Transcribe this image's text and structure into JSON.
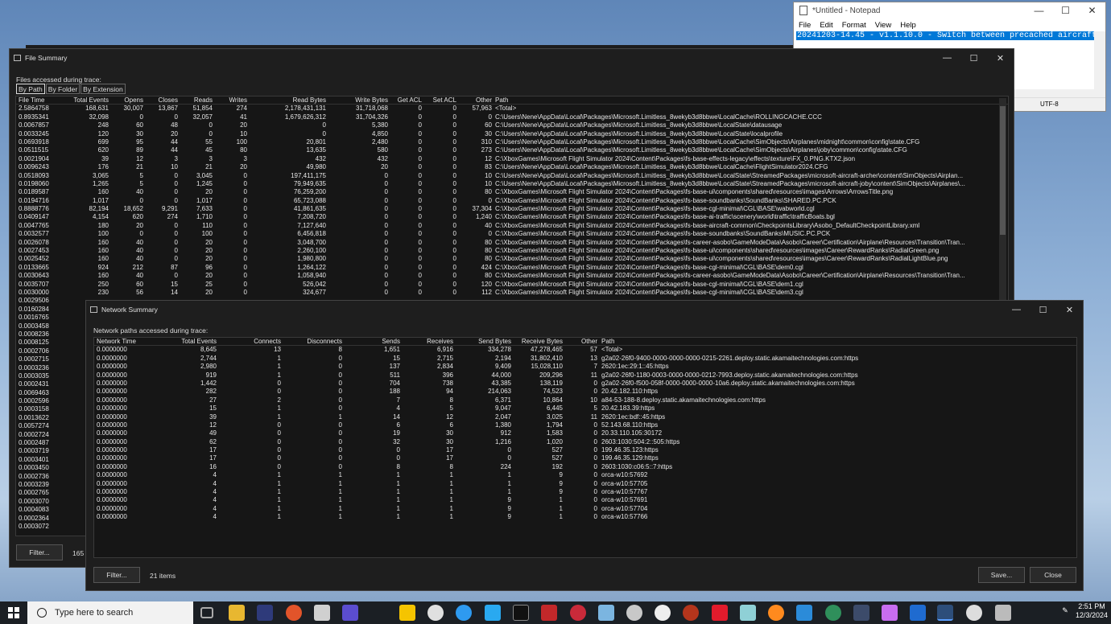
{
  "notepad": {
    "title": "*Untitled - Notepad",
    "menu": [
      "File",
      "Edit",
      "Format",
      "View",
      "Help"
    ],
    "selected_text": "20241203-14.45 - v1.1.10.0 - Switch between precached aircraft",
    "status_line": "F)",
    "status_encoding": "UTF-8"
  },
  "file_summary": {
    "title": "File Summary",
    "label": "Files accessed during trace:",
    "tabs": [
      "By Path",
      "By Folder",
      "By Extension"
    ],
    "active_tab": "By Path",
    "columns": [
      "File Time",
      "Total Events",
      "Opens",
      "Closes",
      "Reads",
      "Writes",
      "Read Bytes",
      "Write Bytes",
      "Get ACL",
      "Set ACL",
      "Other",
      "Path"
    ],
    "rows": [
      [
        "2.5864758",
        "168,631",
        "30,007",
        "13,867",
        "51,854",
        "274",
        "2,178,431,131",
        "31,718,068",
        "0",
        "0",
        "57,963",
        "<Total>"
      ],
      [
        "0.8935341",
        "32,098",
        "0",
        "0",
        "32,057",
        "41",
        "1,679,626,312",
        "31,704,326",
        "0",
        "0",
        "0",
        "C:\\Users\\Nene\\AppData\\Local\\Packages\\Microsoft.Limitless_8wekyb3d8bbwe\\LocalCache\\ROLLINGCACHE.CCC"
      ],
      [
        "0.0067857",
        "248",
        "60",
        "48",
        "0",
        "20",
        "0",
        "5,380",
        "0",
        "0",
        "60",
        "C:\\Users\\Nene\\AppData\\Local\\Packages\\Microsoft.Limitless_8wekyb3d8bbwe\\LocalState\\datausage"
      ],
      [
        "0.0033245",
        "120",
        "30",
        "20",
        "0",
        "10",
        "0",
        "4,850",
        "0",
        "0",
        "30",
        "C:\\Users\\Nene\\AppData\\Local\\Packages\\Microsoft.Limitless_8wekyb3d8bbwe\\LocalState\\localprofile"
      ],
      [
        "0.0693918",
        "699",
        "95",
        "44",
        "55",
        "100",
        "20,801",
        "2,480",
        "0",
        "0",
        "310",
        "C:\\Users\\Nene\\AppData\\Local\\Packages\\Microsoft.Limitless_8wekyb3d8bbwe\\LocalCache\\SimObjects\\Airplanes\\midnight\\common\\config\\state.CFG"
      ],
      [
        "0.0511515",
        "620",
        "89",
        "44",
        "45",
        "80",
        "13,635",
        "580",
        "0",
        "0",
        "273",
        "C:\\Users\\Nene\\AppData\\Local\\Packages\\Microsoft.Limitless_8wekyb3d8bbwe\\LocalCache\\SimObjects\\Airplanes\\joby\\common\\config\\state.CFG"
      ],
      [
        "0.0021904",
        "39",
        "12",
        "3",
        "3",
        "3",
        "432",
        "432",
        "0",
        "0",
        "12",
        "C:\\XboxGames\\Microsoft Flight Simulator 2024\\Content\\Packages\\fs-base-effects-legacy\\effects\\texture\\FX_0.PNG.KTX2.json"
      ],
      [
        "0.0096243",
        "176",
        "21",
        "10",
        "21",
        "20",
        "49,980",
        "20",
        "0",
        "0",
        "83",
        "C:\\Users\\Nene\\AppData\\Local\\Packages\\Microsoft.Limitless_8wekyb3d8bbwe\\LocalCache\\FlightSimulator2024.CFG"
      ],
      [
        "0.0518093",
        "3,065",
        "5",
        "0",
        "3,045",
        "0",
        "197,411,175",
        "0",
        "0",
        "0",
        "10",
        "C:\\Users\\Nene\\AppData\\Local\\Packages\\Microsoft.Limitless_8wekyb3d8bbwe\\LocalState\\StreamedPackages\\microsoft-aircraft-archer\\content\\SimObjects\\Airplan..."
      ],
      [
        "0.0198060",
        "1,265",
        "5",
        "0",
        "1,245",
        "0",
        "79,949,635",
        "0",
        "0",
        "0",
        "10",
        "C:\\Users\\Nene\\AppData\\Local\\Packages\\Microsoft.Limitless_8wekyb3d8bbwe\\LocalState\\StreamedPackages\\microsoft-aircraft-joby\\content\\SimObjects\\Airplanes\\..."
      ],
      [
        "0.0189587",
        "160",
        "40",
        "0",
        "20",
        "0",
        "76,259,200",
        "0",
        "0",
        "0",
        "80",
        "C:\\XboxGames\\Microsoft Flight Simulator 2024\\Content\\Packages\\fs-base-ui\\components\\shared\\resources\\images\\Arrows\\ArrowsTitle.png"
      ],
      [
        "0.0194716",
        "1,017",
        "0",
        "0",
        "1,017",
        "0",
        "65,723,088",
        "0",
        "0",
        "0",
        "0",
        "C:\\XboxGames\\Microsoft Flight Simulator 2024\\Content\\Packages\\fs-base-soundbanks\\SoundBanks\\SHARED.PC.PCK"
      ],
      [
        "0.8888776",
        "82,194",
        "18,652",
        "9,291",
        "7,633",
        "0",
        "41,861,635",
        "0",
        "0",
        "0",
        "37,304",
        "C:\\XboxGames\\Microsoft Flight Simulator 2024\\Content\\Packages\\fs-base-cgl-minimal\\CGL\\BASE\\wabworld.cgl"
      ],
      [
        "0.0409147",
        "4,154",
        "620",
        "274",
        "1,710",
        "0",
        "7,208,720",
        "0",
        "0",
        "0",
        "1,240",
        "C:\\XboxGames\\Microsoft Flight Simulator 2024\\Content\\Packages\\fs-base-ai-traffic\\scenery\\world\\traffic\\trafficBoats.bgl"
      ],
      [
        "0.0047765",
        "180",
        "20",
        "0",
        "110",
        "0",
        "7,127,640",
        "0",
        "0",
        "0",
        "40",
        "C:\\XboxGames\\Microsoft Flight Simulator 2024\\Content\\Packages\\fs-base-aircraft-common\\CheckpointsLibrary\\Asobo_DefaultCheckpointLibrary.xml"
      ],
      [
        "0.0032577",
        "100",
        "0",
        "0",
        "100",
        "0",
        "6,456,818",
        "0",
        "0",
        "0",
        "0",
        "C:\\XboxGames\\Microsoft Flight Simulator 2024\\Content\\Packages\\fs-base-soundbanks\\SoundBanks\\MUSIC.PC.PCK"
      ],
      [
        "0.0026078",
        "160",
        "40",
        "0",
        "20",
        "0",
        "3,048,700",
        "0",
        "0",
        "0",
        "80",
        "C:\\XboxGames\\Microsoft Flight Simulator 2024\\Content\\Packages\\fs-career-asobo\\GameModeData\\Asobo\\Career\\Certification\\Airplane\\Resources\\Transition\\Tran..."
      ],
      [
        "0.0027453",
        "160",
        "40",
        "0",
        "20",
        "0",
        "2,260,100",
        "0",
        "0",
        "0",
        "80",
        "C:\\XboxGames\\Microsoft Flight Simulator 2024\\Content\\Packages\\fs-base-ui\\components\\shared\\resources\\images\\Career\\RewardRanks\\RadialGreen.png"
      ],
      [
        "0.0025452",
        "160",
        "40",
        "0",
        "20",
        "0",
        "1,980,800",
        "0",
        "0",
        "0",
        "80",
        "C:\\XboxGames\\Microsoft Flight Simulator 2024\\Content\\Packages\\fs-base-ui\\components\\shared\\resources\\images\\Career\\RewardRanks\\RadialLightBlue.png"
      ],
      [
        "0.0133665",
        "924",
        "212",
        "87",
        "96",
        "0",
        "1,264,122",
        "0",
        "0",
        "0",
        "424",
        "C:\\XboxGames\\Microsoft Flight Simulator 2024\\Content\\Packages\\fs-base-cgl-minimal\\CGL\\BASE\\dem0.cgl"
      ],
      [
        "0.0030643",
        "160",
        "40",
        "0",
        "20",
        "0",
        "1,058,940",
        "0",
        "0",
        "0",
        "80",
        "C:\\XboxGames\\Microsoft Flight Simulator 2024\\Content\\Packages\\fs-career-asobo\\GameModeData\\Asobo\\Career\\Certification\\Airplane\\Resources\\Transition\\Tran..."
      ],
      [
        "0.0035707",
        "250",
        "60",
        "15",
        "25",
        "0",
        "526,042",
        "0",
        "0",
        "0",
        "120",
        "C:\\XboxGames\\Microsoft Flight Simulator 2024\\Content\\Packages\\fs-base-cgl-minimal\\CGL\\BASE\\dem1.cgl"
      ],
      [
        "0.0030000",
        "230",
        "56",
        "14",
        "20",
        "0",
        "324,677",
        "0",
        "0",
        "0",
        "112",
        "C:\\XboxGames\\Microsoft Flight Simulator 2024\\Content\\Packages\\fs-base-cgl-minimal\\CGL\\BASE\\dem3.cgl"
      ]
    ],
    "hidden_times": [
      "0.0029506",
      "0.0160284",
      "0.0016765",
      "0.0003458",
      "0.0008236",
      "0.0008125",
      "0.0002706",
      "0.0002715",
      "0.0003236",
      "0.0003035",
      "0.0002431",
      "0.0069463",
      "0.0002596",
      "0.0003158",
      "0.0013622",
      "0.0057274",
      "0.0002724",
      "0.0002487",
      "0.0003719",
      "0.0003401",
      "0.0003450",
      "0.0002736",
      "0.0003239",
      "0.0002765",
      "0.0003070",
      "0.0004083",
      "0.0002364",
      "0.0003072"
    ],
    "filter_button": "Filter...",
    "count_label": "165"
  },
  "network_summary": {
    "title": "Network Summary",
    "label": "Network paths accessed during trace:",
    "columns": [
      "Network Time",
      "Total Events",
      "Connects",
      "Disconnects",
      "Sends",
      "Receives",
      "Send Bytes",
      "Receive Bytes",
      "Other",
      "Path"
    ],
    "rows": [
      [
        "0.0000000",
        "8,645",
        "13",
        "8",
        "1,651",
        "6,916",
        "334,278",
        "47,278,465",
        "57",
        "<Total>"
      ],
      [
        "0.0000000",
        "2,744",
        "1",
        "0",
        "15",
        "2,715",
        "2,194",
        "31,802,410",
        "13",
        "g2a02-26f0-9400-0000-0000-0000-0215-2261.deploy.static.akamaitechnologies.com:https"
      ],
      [
        "0.0000000",
        "2,980",
        "1",
        "0",
        "137",
        "2,834",
        "9,409",
        "15,028,110",
        "7",
        "2620:1ec:29:1::45:https"
      ],
      [
        "0.0000000",
        "919",
        "1",
        "0",
        "511",
        "396",
        "44,000",
        "209,296",
        "11",
        "g2a02-26f0-1180-0003-0000-0000-0212-7993.deploy.static.akamaitechnologies.com:https"
      ],
      [
        "0.0000000",
        "1,442",
        "0",
        "0",
        "704",
        "738",
        "43,385",
        "138,119",
        "0",
        "g2a02-26f0-f500-058f-0000-0000-0000-10a6.deploy.static.akamaitechnologies.com:https"
      ],
      [
        "0.0000000",
        "282",
        "0",
        "0",
        "188",
        "94",
        "214,063",
        "74,523",
        "0",
        "20.42.182.110:https"
      ],
      [
        "0.0000000",
        "27",
        "2",
        "0",
        "7",
        "8",
        "6,371",
        "10,864",
        "10",
        "a84-53-188-8.deploy.static.akamaitechnologies.com:https"
      ],
      [
        "0.0000000",
        "15",
        "1",
        "0",
        "4",
        "5",
        "9,047",
        "6,445",
        "5",
        "20.42.183.39:https"
      ],
      [
        "0.0000000",
        "39",
        "1",
        "1",
        "14",
        "12",
        "2,047",
        "3,025",
        "11",
        "2620:1ec:bdf::45:https"
      ],
      [
        "0.0000000",
        "12",
        "0",
        "0",
        "6",
        "6",
        "1,380",
        "1,794",
        "0",
        "52.143.68.110:https"
      ],
      [
        "0.0000000",
        "49",
        "0",
        "0",
        "19",
        "30",
        "912",
        "1,583",
        "0",
        "20.33.110.105:30172"
      ],
      [
        "0.0000000",
        "62",
        "0",
        "0",
        "32",
        "30",
        "1,216",
        "1,020",
        "0",
        "2603:1030:504:2::505:https"
      ],
      [
        "0.0000000",
        "17",
        "0",
        "0",
        "0",
        "17",
        "0",
        "527",
        "0",
        "199.46.35.123:https"
      ],
      [
        "0.0000000",
        "17",
        "0",
        "0",
        "0",
        "17",
        "0",
        "527",
        "0",
        "199.46.35.129:https"
      ],
      [
        "0.0000000",
        "16",
        "0",
        "0",
        "8",
        "8",
        "224",
        "192",
        "0",
        "2603:1030:c06:5::7:https"
      ],
      [
        "0.0000000",
        "4",
        "1",
        "1",
        "1",
        "1",
        "1",
        "9",
        "0",
        "orca-w10:57692"
      ],
      [
        "0.0000000",
        "4",
        "1",
        "1",
        "1",
        "1",
        "1",
        "9",
        "0",
        "orca-w10:57705"
      ],
      [
        "0.0000000",
        "4",
        "1",
        "1",
        "1",
        "1",
        "1",
        "9",
        "0",
        "orca-w10:57767"
      ],
      [
        "0.0000000",
        "4",
        "1",
        "1",
        "1",
        "1",
        "9",
        "1",
        "0",
        "orca-w10:57691"
      ],
      [
        "0.0000000",
        "4",
        "1",
        "1",
        "1",
        "1",
        "9",
        "1",
        "0",
        "orca-w10:57704"
      ],
      [
        "0.0000000",
        "4",
        "1",
        "1",
        "1",
        "1",
        "9",
        "1",
        "0",
        "orca-w10:57766"
      ]
    ],
    "filter_button": "Filter...",
    "items_label": "21 items",
    "save_button": "Save...",
    "close_button": "Close"
  },
  "taskbar": {
    "search_placeholder": "Type here to search",
    "time": "2:51 PM",
    "date": "12/3/2024"
  }
}
